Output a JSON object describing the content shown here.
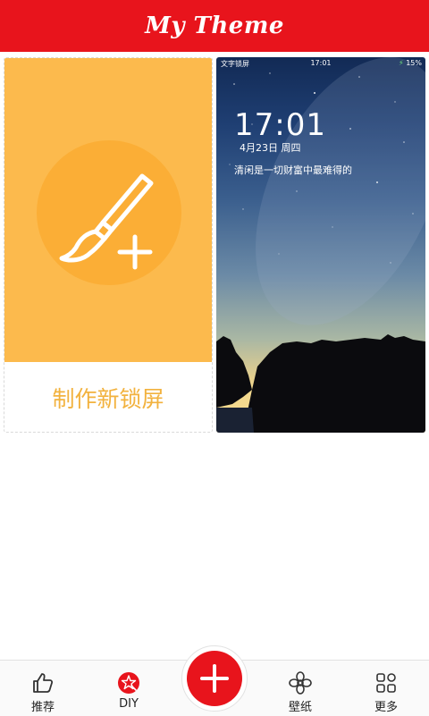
{
  "app_title": "My Theme",
  "diy_card": {
    "label": "制作新锁屏"
  },
  "preview": {
    "status_left": "文字锁屏",
    "status_time": "17:01",
    "battery": "15%",
    "time": "17:01",
    "date": "4月23日  周四",
    "quote": "清闲是一切财富中最难得的"
  },
  "nav": {
    "items": [
      {
        "label": "推荐",
        "icon": "thumbs-up-icon"
      },
      {
        "label": "DIY",
        "icon": "magic-star-icon"
      },
      {
        "label": "",
        "icon": "plus-icon"
      },
      {
        "label": "壁纸",
        "icon": "flower-icon"
      },
      {
        "label": "更多",
        "icon": "grid-icon"
      }
    ]
  },
  "colors": {
    "brand_red": "#e8141c",
    "diy_yellow": "#fcba4d",
    "diy_text": "#f2b23e"
  }
}
